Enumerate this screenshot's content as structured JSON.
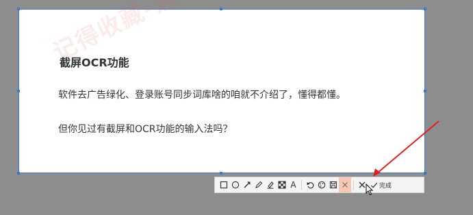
{
  "screenshot": {
    "heading": "截屏OCR功能",
    "paragraph1": "软件去广告绿化、登录账号同步词库啥的咱就不介绍了，懂得都懂。",
    "paragraph2": "但你见过有截屏和OCR功能的输入法吗？",
    "watermark": "记得收藏-黑域基地  Hybase.com"
  },
  "toolbar": {
    "tools": [
      {
        "name": "rectangle",
        "icon": "rectangle-icon"
      },
      {
        "name": "ellipse",
        "icon": "ellipse-icon"
      },
      {
        "name": "arrow",
        "icon": "arrow-icon"
      },
      {
        "name": "pen",
        "icon": "pen-icon"
      },
      {
        "name": "highlighter",
        "icon": "highlighter-icon"
      },
      {
        "name": "mosaic",
        "icon": "mosaic-icon"
      },
      {
        "name": "text",
        "icon": "text-icon",
        "glyph": "A"
      },
      {
        "name": "undo",
        "icon": "undo-icon"
      },
      {
        "name": "ocr",
        "icon": "palette-icon"
      },
      {
        "name": "save",
        "icon": "save-icon"
      },
      {
        "name": "pin",
        "icon": "pin-icon",
        "active": true
      },
      {
        "name": "cancel",
        "icon": "close-icon"
      }
    ],
    "finish_label": "完成"
  },
  "colors": {
    "selection_border": "#3c78c8",
    "annotation_arrow": "#e02020",
    "active_tool_bg": "#f6c7b2",
    "backdrop": "#8d8d8d"
  }
}
